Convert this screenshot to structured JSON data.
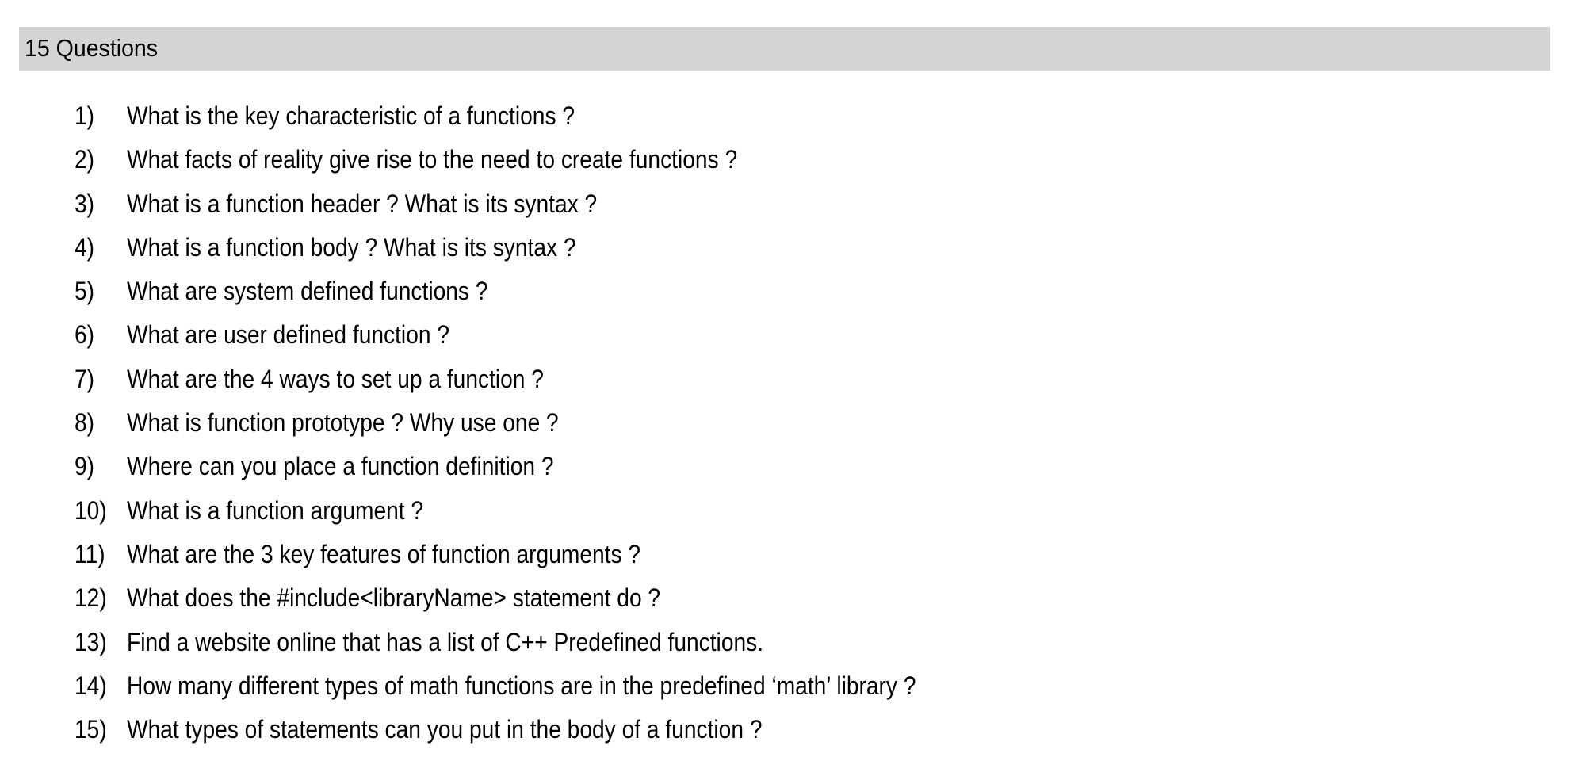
{
  "header": {
    "title": "15 Questions",
    "background_color": "#d4d4d4"
  },
  "questions": [
    {
      "number": "1)",
      "text": "What is the key characteristic of a functions ?"
    },
    {
      "number": "2)",
      "text": "What facts of reality give rise to the need to create functions ?"
    },
    {
      "number": "3)",
      "text": "What is a function header ? What is its syntax ?"
    },
    {
      "number": "4)",
      "text": "What is a function body ?  What is its syntax ?"
    },
    {
      "number": "5)",
      "text": "What are system defined functions ?"
    },
    {
      "number": "6)",
      "text": "What are user defined function ?"
    },
    {
      "number": "7)",
      "text": "What are the 4 ways to set up a function ?"
    },
    {
      "number": "8)",
      "text": "What is function prototype ? Why use one ?"
    },
    {
      "number": "9)",
      "text": "Where can you place a function definition ?"
    },
    {
      "number": "10)",
      "text": "What is a function argument ?"
    },
    {
      "number": "11)",
      "text": "What are the 3 key features of function arguments ?"
    },
    {
      "number": "12)",
      "text": "What does the #include<libraryName> statement do ?"
    },
    {
      "number": "13)",
      "text": "Find a website online that has a list of C++ Predefined functions."
    },
    {
      "number": "14)",
      "text": "How many different types of math functions are in the predefined ‘math’ library ?"
    },
    {
      "number": "15)",
      "text": "What types of statements can you put in the body of a function ?"
    }
  ]
}
